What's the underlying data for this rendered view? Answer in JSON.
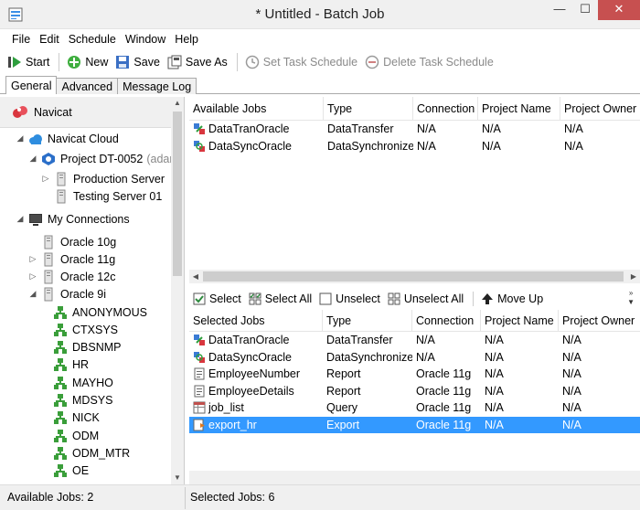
{
  "window": {
    "title": "* Untitled - Batch Job",
    "minimize": "—",
    "maximize": "☐",
    "close": "✕"
  },
  "menu": [
    "File",
    "Edit",
    "Schedule",
    "Window",
    "Help"
  ],
  "toolbar": {
    "start": "Start",
    "new": "New",
    "save": "Save",
    "save_as": "Save As",
    "set_task_schedule": "Set Task Schedule",
    "delete_task_schedule": "Delete Task Schedule"
  },
  "tabs": [
    "General",
    "Advanced",
    "Message Log"
  ],
  "tree": {
    "navicat": "Navicat",
    "cloud": "Navicat Cloud",
    "project": "Project DT-0052",
    "project_owner": "(adam",
    "production": "Production Server",
    "testing": "Testing Server 01",
    "my_connections": "My Connections",
    "oracle10": "Oracle 10g",
    "oracle11": "Oracle 11g",
    "oracle12": "Oracle 12c",
    "oracle9": "Oracle 9i",
    "schemas": [
      "ANONYMOUS",
      "CTXSYS",
      "DBSNMP",
      "HR",
      "MAYHO",
      "MDSYS",
      "NICK",
      "ODM",
      "ODM_MTR",
      "OE"
    ]
  },
  "available": {
    "headers": [
      "Available Jobs",
      "Type",
      "Connection",
      "Project Name",
      "Project Owner"
    ],
    "rows": [
      {
        "name": "DataTranOracle",
        "type": "DataTransfer",
        "connection": "N/A",
        "project": "N/A",
        "owner": "N/A"
      },
      {
        "name": "DataSyncOracle",
        "type": "DataSynchronize",
        "connection": "N/A",
        "project": "N/A",
        "owner": "N/A"
      }
    ]
  },
  "midbar": {
    "select": "Select",
    "select_all": "Select All",
    "unselect": "Unselect",
    "unselect_all": "Unselect All",
    "move_up": "Move Up"
  },
  "selected": {
    "headers": [
      "Selected Jobs",
      "Type",
      "Connection",
      "Project Name",
      "Project Owner"
    ],
    "rows": [
      {
        "name": "DataTranOracle",
        "type": "DataTransfer",
        "connection": "N/A",
        "project": "N/A",
        "owner": "N/A"
      },
      {
        "name": "DataSyncOracle",
        "type": "DataSynchronize",
        "connection": "N/A",
        "project": "N/A",
        "owner": "N/A"
      },
      {
        "name": "EmployeeNumber",
        "type": "Report",
        "connection": "Oracle 11g",
        "project": "N/A",
        "owner": "N/A"
      },
      {
        "name": "EmployeeDetails",
        "type": "Report",
        "connection": "Oracle 11g",
        "project": "N/A",
        "owner": "N/A"
      },
      {
        "name": "job_list",
        "type": "Query",
        "connection": "Oracle 11g",
        "project": "N/A",
        "owner": "N/A"
      },
      {
        "name": "export_hr",
        "type": "Export",
        "connection": "Oracle 11g",
        "project": "N/A",
        "owner": "N/A"
      }
    ]
  },
  "status": {
    "available": "Available Jobs: 2",
    "selected": "Selected Jobs: 6"
  },
  "colors": {
    "selection": "#3399ff",
    "close_button": "#c75050",
    "chrome": "#f0f0f0"
  }
}
